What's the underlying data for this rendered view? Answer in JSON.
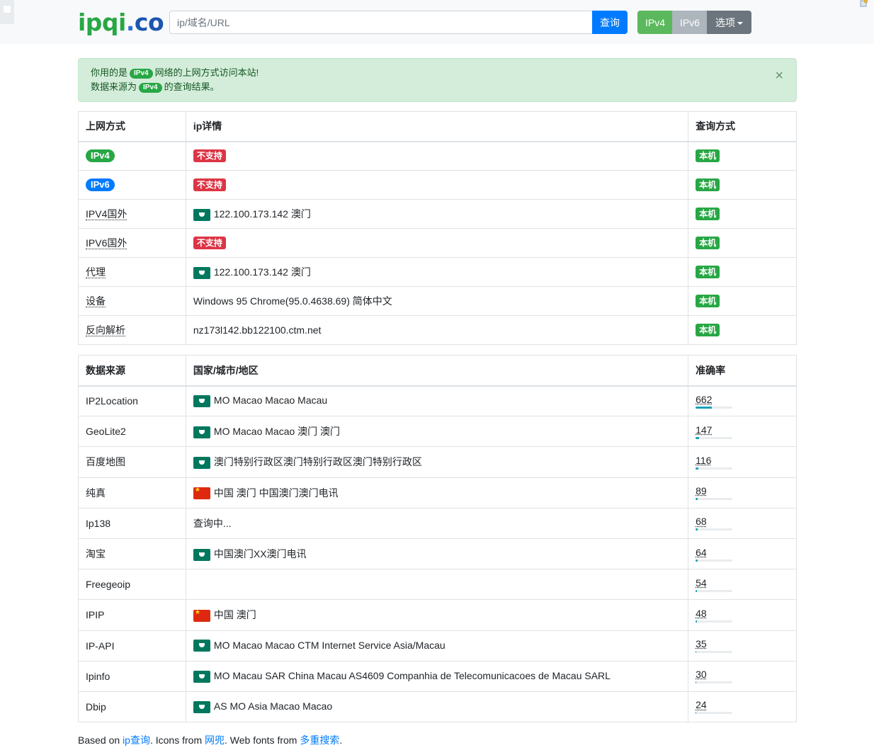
{
  "navbar": {
    "logo": {
      "part1": "ipqi",
      "part2": ".",
      "part3": "co"
    },
    "search_placeholder": "ip/域名/URL",
    "search_button": "查询",
    "ipv4_button": "IPv4",
    "ipv6_button": "IPv6",
    "options_button": "选项"
  },
  "alert": {
    "line1_prefix": "你用的是",
    "line1_pill": "IPv4",
    "line1_suffix": "网络的上网方式访问本站!",
    "line2_prefix": "数据来源为",
    "line2_pill": "IPv4",
    "line2_suffix": "的查询结果。",
    "close": "×"
  },
  "table1": {
    "headers": [
      "上网方式",
      "ip详情",
      "查询方式"
    ],
    "rows": [
      {
        "method": "IPv4",
        "method_style": "pill-green",
        "detail": "不支持",
        "detail_style": "badge-red",
        "flag": "",
        "query": "本机"
      },
      {
        "method": "IPv6",
        "method_style": "pill-blue",
        "detail": "不支持",
        "detail_style": "badge-red",
        "flag": "",
        "query": "本机"
      },
      {
        "method": "IPV4国外",
        "method_style": "dotted",
        "detail": "122.100.173.142 澳门",
        "detail_style": "text",
        "flag": "mo",
        "query": "本机"
      },
      {
        "method": "IPV6国外",
        "method_style": "dotted",
        "detail": "不支持",
        "detail_style": "badge-red",
        "flag": "",
        "query": "本机"
      },
      {
        "method": "代理",
        "method_style": "dotted",
        "detail": "122.100.173.142 澳门",
        "detail_style": "text",
        "flag": "mo",
        "query": "本机"
      },
      {
        "method": "设备",
        "method_style": "dotted",
        "detail": "Windows 95 Chrome(95.0.4638.69) 简体中文",
        "detail_style": "text",
        "flag": "",
        "query": "本机"
      },
      {
        "method": "反向解析",
        "method_style": "dotted",
        "detail": " nz173l142.bb122100.ctm.net",
        "detail_style": "text",
        "flag": "",
        "query": "本机"
      }
    ]
  },
  "table2": {
    "headers": [
      "数据来源",
      "国家/城市/地区",
      "准确率"
    ],
    "rows": [
      {
        "source": "IP2Location",
        "flag": "mo",
        "location": "MO Macao Macao Macau",
        "accuracy": "662",
        "accuracy_fraction": 0.45
      },
      {
        "source": "GeoLite2",
        "flag": "mo",
        "location": "MO Macao Macao 澳门 澳门",
        "accuracy": "147",
        "accuracy_fraction": 0.1
      },
      {
        "source": "百度地图",
        "flag": "mo",
        "location": "澳门特别行政区澳门特别行政区澳门特别行政区",
        "accuracy": "116",
        "accuracy_fraction": 0.08
      },
      {
        "source": "纯真",
        "flag": "cn",
        "location": "中国 澳门 中国澳门澳门电讯",
        "accuracy": "89",
        "accuracy_fraction": 0.06
      },
      {
        "source": "Ip138",
        "flag": "",
        "location": "查询中...",
        "accuracy": "68",
        "accuracy_fraction": 0.05
      },
      {
        "source": "淘宝",
        "flag": "mo",
        "location": "中国澳门XX澳门电讯",
        "accuracy": "64",
        "accuracy_fraction": 0.05
      },
      {
        "source": "Freegeoip",
        "flag": "",
        "location": "",
        "accuracy": "54",
        "accuracy_fraction": 0.04
      },
      {
        "source": "IPIP",
        "flag": "cn",
        "location": "中国 澳门",
        "accuracy": "48",
        "accuracy_fraction": 0.035
      },
      {
        "source": "IP-API",
        "flag": "mo",
        "location": "MO Macao Macao CTM Internet Service Asia/Macau",
        "accuracy": "35",
        "accuracy_fraction": 0.025
      },
      {
        "source": "Ipinfo",
        "flag": "mo",
        "location": "MO Macau SAR China Macau AS4609 Companhia de Telecomunicacoes de Macau SARL",
        "accuracy": "30",
        "accuracy_fraction": 0.02
      },
      {
        "source": "Dbip",
        "flag": "mo",
        "location": "AS MO Asia Macao Macao",
        "accuracy": "24",
        "accuracy_fraction": 0.02
      }
    ]
  },
  "footer": {
    "t1": "Based on ",
    "link1": "ip查询",
    "t2": ". Icons from ",
    "link2": "网兜",
    "t3": ". Web fonts from ",
    "link3": "多重搜索",
    "t4": "."
  }
}
